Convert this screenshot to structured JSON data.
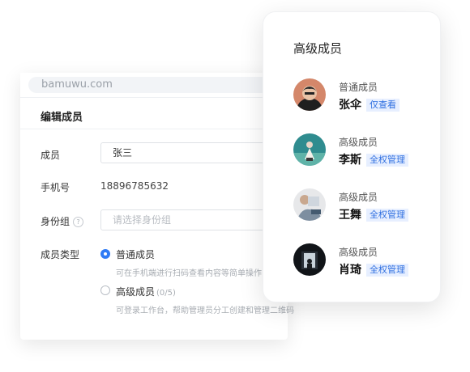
{
  "browser": {
    "url": "bamuwu.com"
  },
  "edit_form": {
    "title": "编辑成员",
    "member_label": "成员",
    "member_value": "张三",
    "phone_label": "手机号",
    "phone_value": "18896785632",
    "group_label": "身份组",
    "group_help_icon": "question-circle-icon",
    "group_placeholder": "请选择身份组",
    "type_label": "成员类型",
    "options": [
      {
        "label": "普通成员",
        "count": "",
        "checked": true,
        "hint": "可在手机端进行扫码查看内容等简单操作"
      },
      {
        "label": "高级成员",
        "count": "(0/5)",
        "checked": false,
        "hint": "可登录工作台，帮助管理员分工创建和管理二维码"
      }
    ],
    "accent": "#2f7bf5"
  },
  "senior_panel": {
    "title": "高级成员",
    "members": [
      {
        "role": "普通成员",
        "name": "张伞",
        "tag": "仅查看"
      },
      {
        "role": "高级成员",
        "name": "李斯",
        "tag": "全权管理"
      },
      {
        "role": "高级成员",
        "name": "王舞",
        "tag": "全权管理"
      },
      {
        "role": "高级成员",
        "name": "肖琦",
        "tag": "全权管理"
      }
    ],
    "tag_color": "#2f6fe0"
  }
}
